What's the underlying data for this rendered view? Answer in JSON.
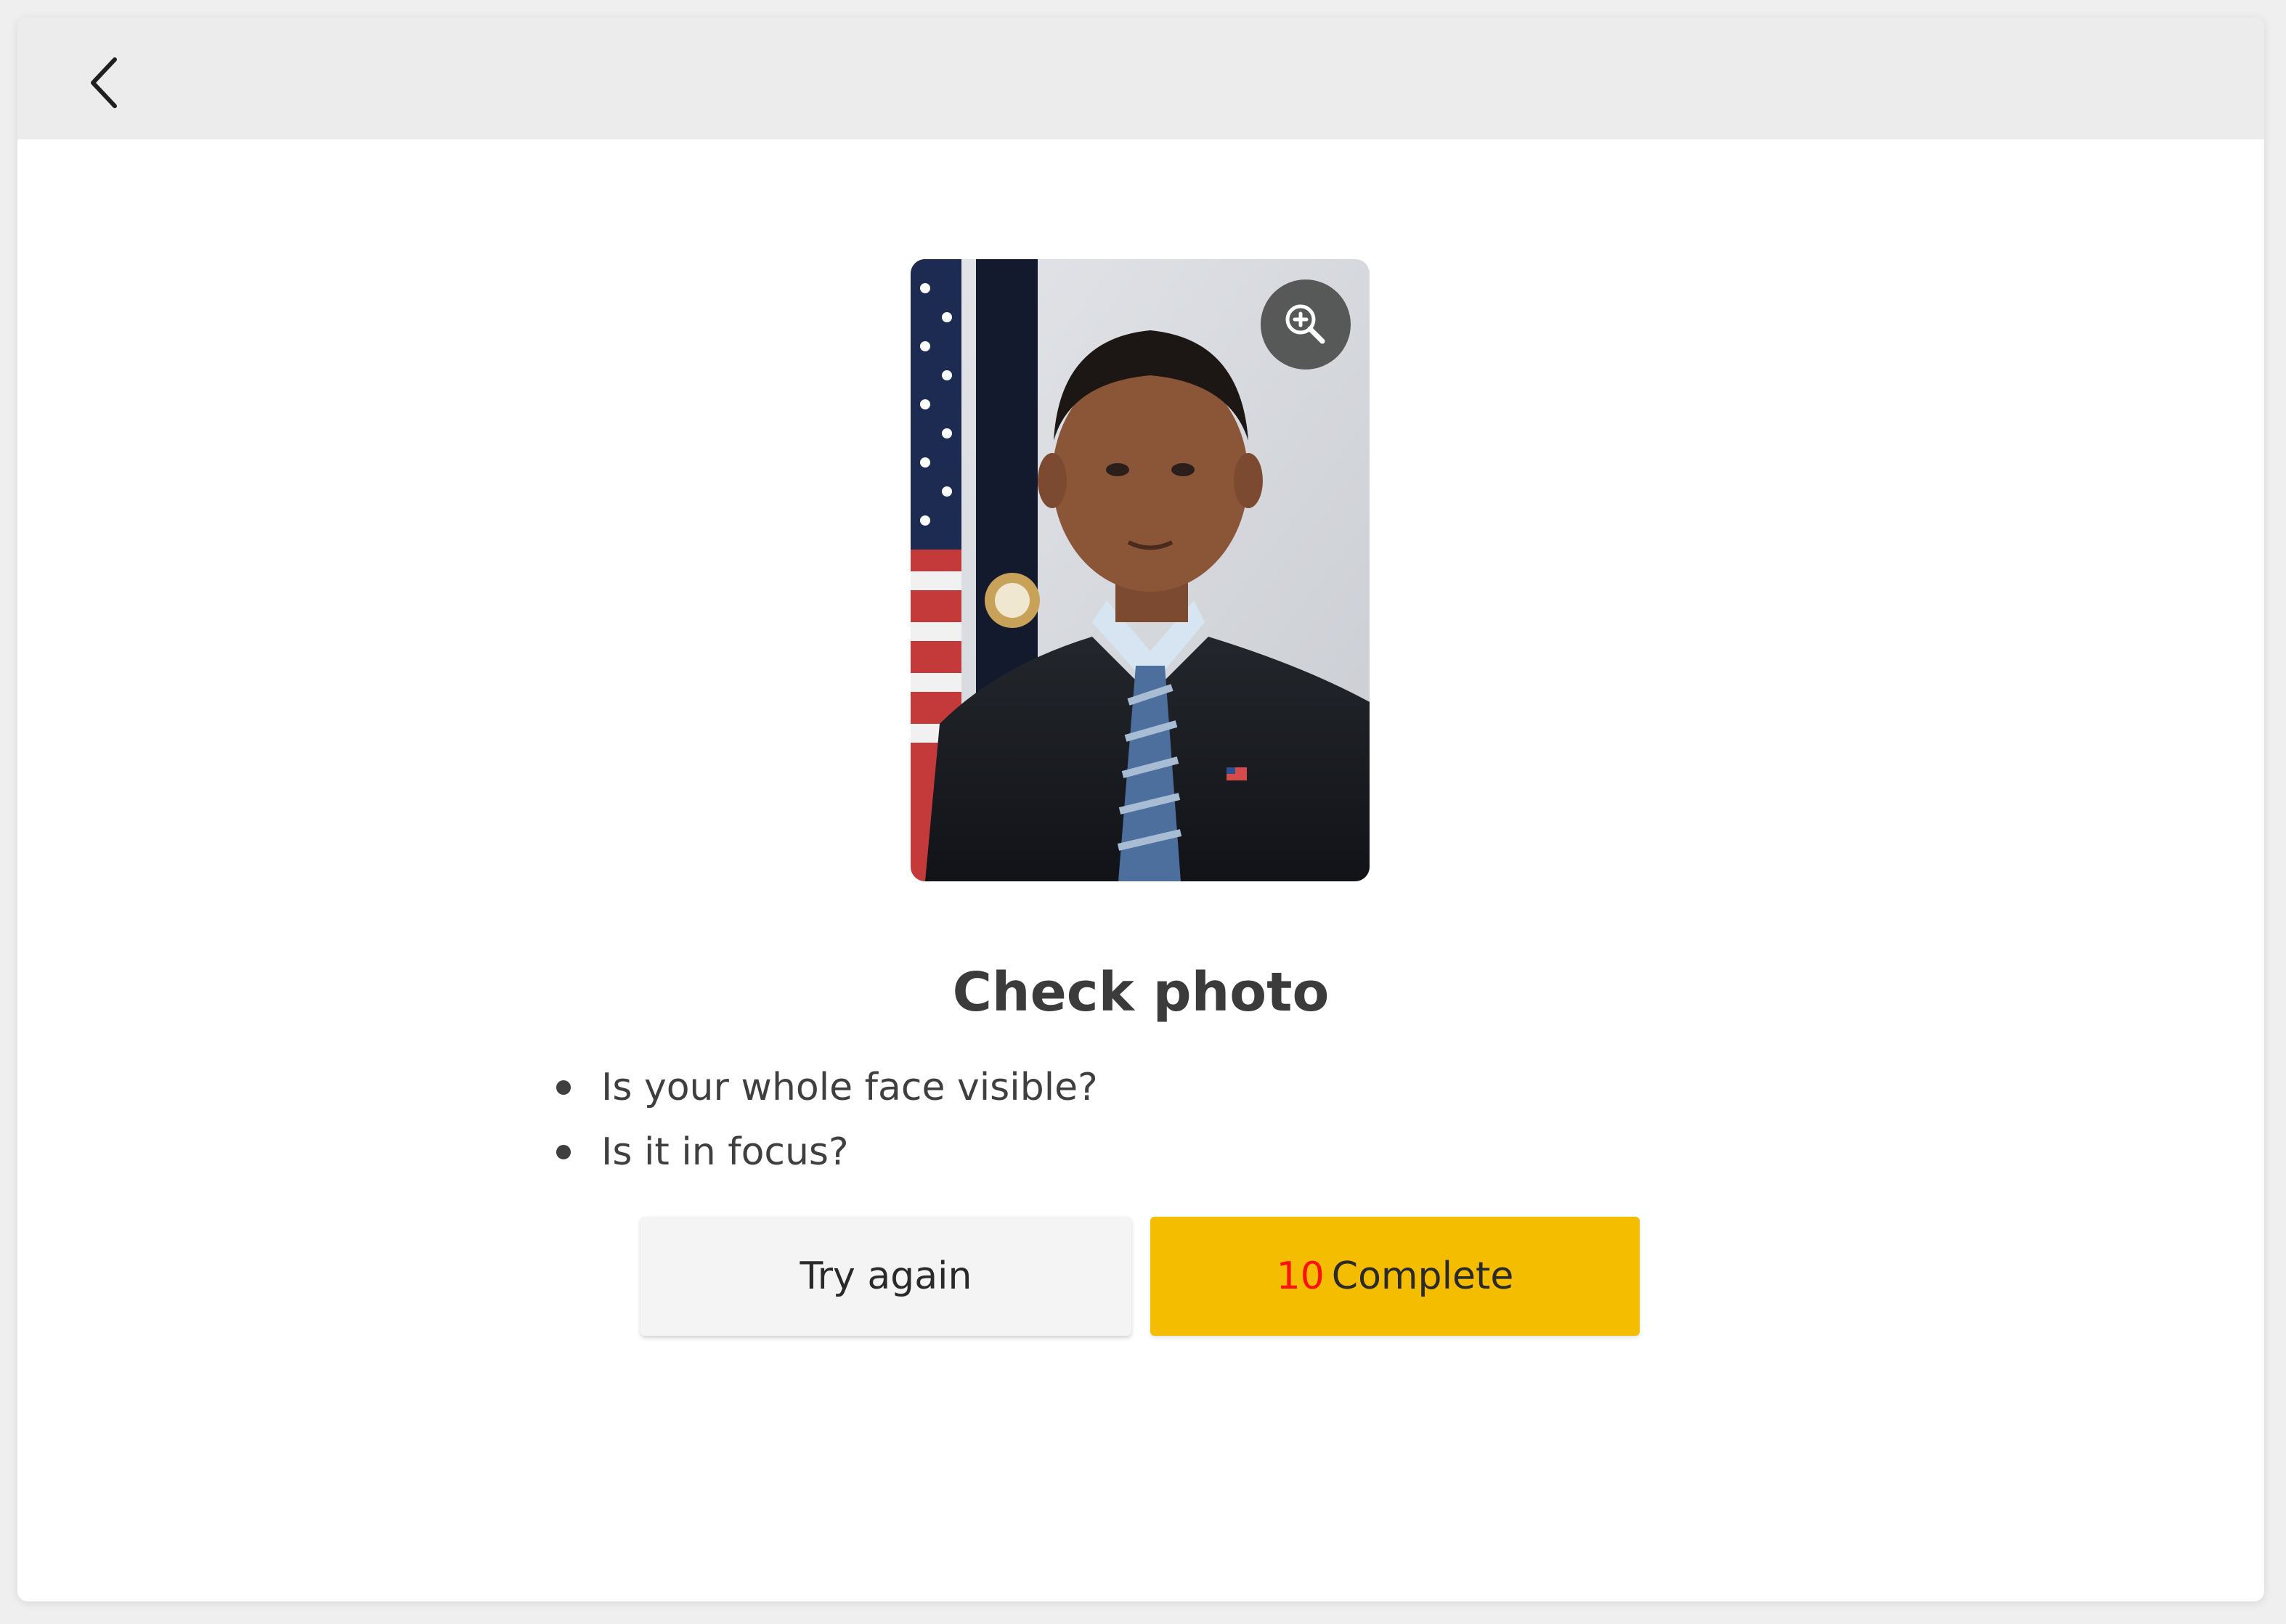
{
  "topbar": {
    "back_icon": "chevron-left-icon"
  },
  "photo": {
    "alt": "Portrait photo",
    "zoom_icon": "zoom-in-icon"
  },
  "content": {
    "title": "Check photo",
    "checklist": [
      "Is your whole face visible?",
      "Is it in focus?"
    ]
  },
  "actions": {
    "try_again_label": "Try again",
    "complete_countdown": "10",
    "complete_label": "Complete"
  },
  "colors": {
    "primary_button": "#f5bd00",
    "secondary_button": "#f4f4f4",
    "countdown": "#ff1010",
    "topbar": "#ececec"
  }
}
